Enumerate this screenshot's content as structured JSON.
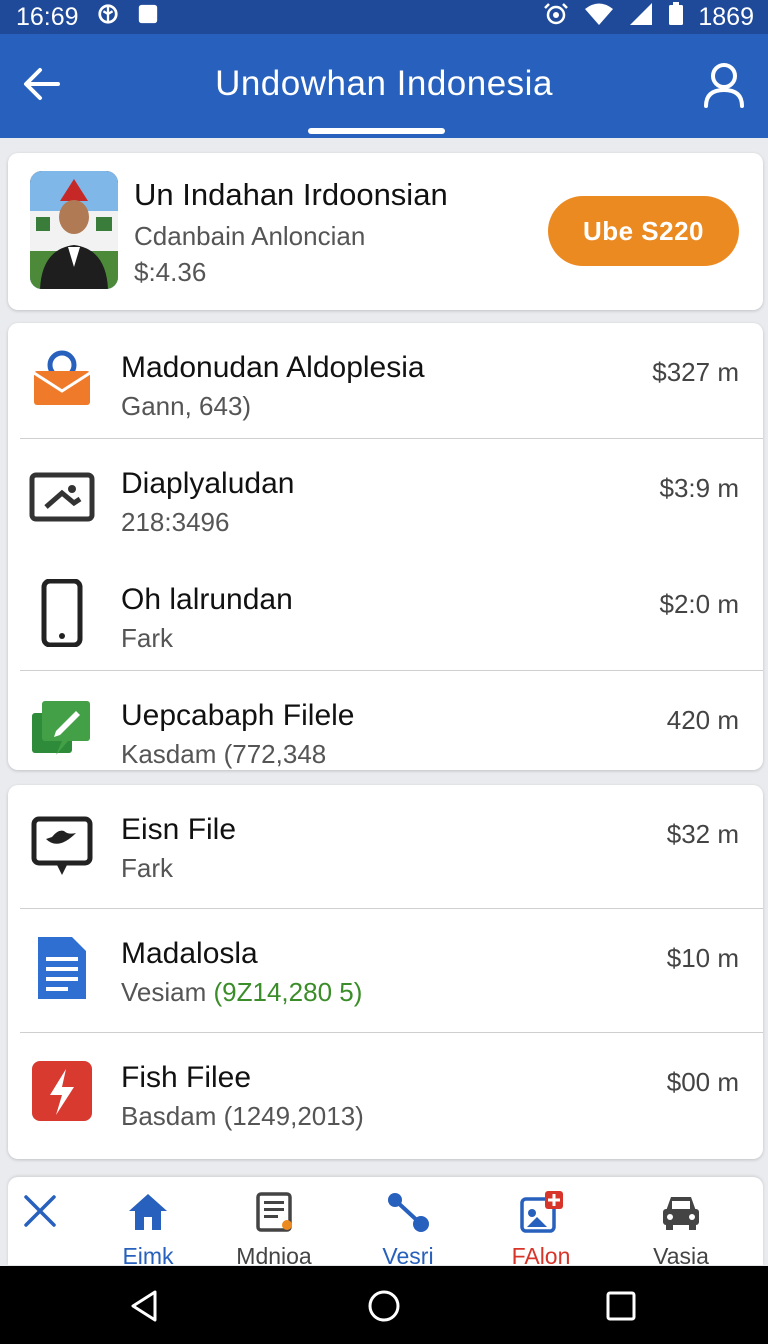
{
  "status": {
    "time": "16:69",
    "battery": "1869"
  },
  "app_bar": {
    "title": "Undowhan  Indonesia"
  },
  "featured": {
    "name": "Un Indahan Irdoonsian",
    "subtitle": "Cdanbain Anloncian",
    "price": "$:4.36",
    "buy_label": "Ube S220"
  },
  "list_a": [
    {
      "icon": "mail-icon",
      "title": "Madonudan Aldoplesia",
      "meta": "Gann, 643)",
      "amount": "$327 m"
    },
    {
      "icon": "image-icon",
      "title": "Diaplyaludan",
      "meta": "218:3496",
      "amount": "$3:9 m"
    },
    {
      "icon": "phone-icon",
      "title": "Oh lalrundan",
      "meta": "Fark",
      "amount": "$2:0 m"
    },
    {
      "icon": "edit-icon",
      "title": "Uepcabaph Filele",
      "meta": "Kasdam (772,348",
      "amount": "420 m"
    }
  ],
  "list_b": [
    {
      "icon": "bird-icon",
      "title": "Eisn File",
      "meta": "Fark",
      "amount": "$32 m"
    },
    {
      "icon": "document-icon",
      "title": "Madalosla",
      "meta_prefix": "Vesiam ",
      "meta_highlight": "(9Z14,280 5)",
      "amount": "$10 m"
    },
    {
      "icon": "flash-icon",
      "title": "Fish Filee",
      "meta": "Basdam (1249,2013)",
      "amount": "$00 m"
    }
  ],
  "bottom_nav": [
    {
      "icon": "close-icon",
      "label": ""
    },
    {
      "icon": "home-icon",
      "label": "Eimk",
      "color": "#2760bd"
    },
    {
      "icon": "news-icon",
      "label": "Mdnioa",
      "color": "#444444"
    },
    {
      "icon": "share-icon",
      "label": "Vesri",
      "color": "#2760bd"
    },
    {
      "icon": "add-photo-icon",
      "label": "FAlon",
      "color": "#d8352a"
    },
    {
      "icon": "car-icon",
      "label": "Vasia",
      "color": "#444444"
    }
  ],
  "colors": {
    "primary": "#2760bd",
    "status_bar": "#1f4a99",
    "accent": "#ec8a22"
  }
}
